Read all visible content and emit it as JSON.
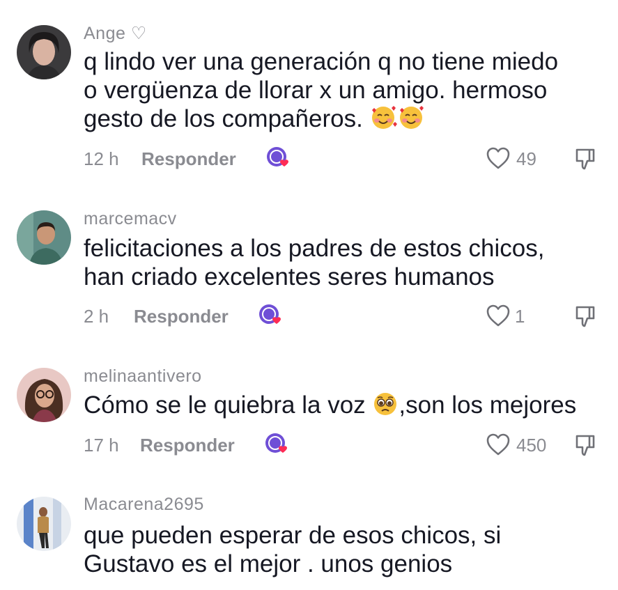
{
  "comments": [
    {
      "username": "Ange ♡",
      "text_lines": [
        "q lindo ver una generación q no tiene miedo",
        "o vergüenza de llorar x un amigo. hermoso",
        "gesto de los compañeros."
      ],
      "emoji": [
        "smiling-face-with-hearts",
        "smiling-face-with-hearts"
      ],
      "time": "12 h",
      "reply_label": "Responder",
      "likes": "49"
    },
    {
      "username": "marcemacv",
      "text_lines": [
        "felicitaciones a los padres de estos chicos,",
        "han criado excelentes seres humanos"
      ],
      "time": "2 h",
      "reply_label": "Responder",
      "likes": "1"
    },
    {
      "username": "melinaantivero",
      "text_before_emoji": "Cómo se le quiebra la voz ",
      "text_after_emoji": ",son los mejores",
      "emoji": [
        "pleading-face"
      ],
      "time": "17 h",
      "reply_label": "Responder",
      "likes": "450"
    },
    {
      "username": "Macarena2695",
      "text_lines": [
        "que pueden esperar de esos chicos, si",
        "Gustavo es el mejor . unos genios"
      ]
    }
  ],
  "colors": {
    "muted": "#8a8b91",
    "text": "#161823",
    "badge": "#6f4fd6",
    "badge_heart": "#fe2c55"
  }
}
